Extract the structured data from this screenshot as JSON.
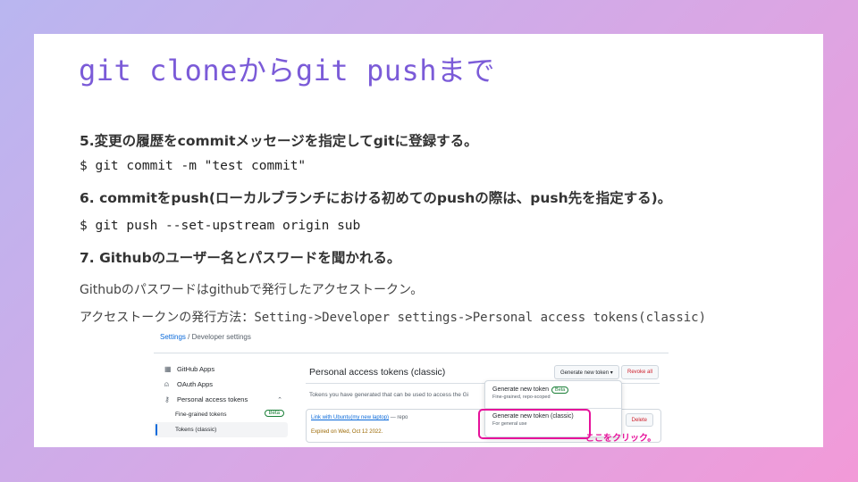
{
  "slide": {
    "title": "git cloneからgit pushまで",
    "step5": "5.変更の履歴をcommitメッセージを指定してgitに登録する。",
    "code5": "$ git commit -m \"test commit\"",
    "step6": "6. commitをpush(ローカルブランチにおける初めてのpushの際は、push先を指定する)。",
    "code6": "$ git push --set-upstream origin sub",
    "step7": "7. Githubのユーザー名とパスワードを聞かれる。",
    "note1": "Githubのパスワードはgithubで発行したアクセストークン。",
    "note2_prefix": "アクセストークンの発行方法：",
    "note2_path": "Setting->Developer settings->Personal access tokens(classic)"
  },
  "github": {
    "breadcrumb_settings": "Settings",
    "breadcrumb_sep": " / ",
    "breadcrumb_dev": "Developer settings",
    "sidebar": [
      {
        "label": "GitHub Apps",
        "icon": "apps-grid-icon"
      },
      {
        "label": "OAuth Apps",
        "icon": "person-icon"
      },
      {
        "label": "Personal access tokens",
        "icon": "key-icon"
      },
      {
        "label": "Fine-grained tokens",
        "badge": "Beta"
      },
      {
        "label": "Tokens (classic)"
      }
    ],
    "main_title": "Personal access tokens (classic)",
    "generate_button": "Generate new token ▾",
    "revoke_button": "Revoke all",
    "description": "Tokens you have generated that can be used to access the Gi",
    "token_link": "Link with Ubuntu(my new laptop)",
    "token_scope": " — repo",
    "token_expiry": "Expired on Wed, Oct 12 2022.",
    "delete_button": "Delete",
    "dropdown": {
      "option1_title": "Generate new token",
      "option1_badge": "Beta",
      "option1_sub": "Fine-grained, repo-scoped",
      "option2_title": "Generate new token (classic)",
      "option2_sub": "For general use"
    },
    "annotation": "ここをクリック。"
  },
  "colors": {
    "title": "#7b5bd8",
    "highlight": "#e6119a",
    "link": "#0969da"
  }
}
